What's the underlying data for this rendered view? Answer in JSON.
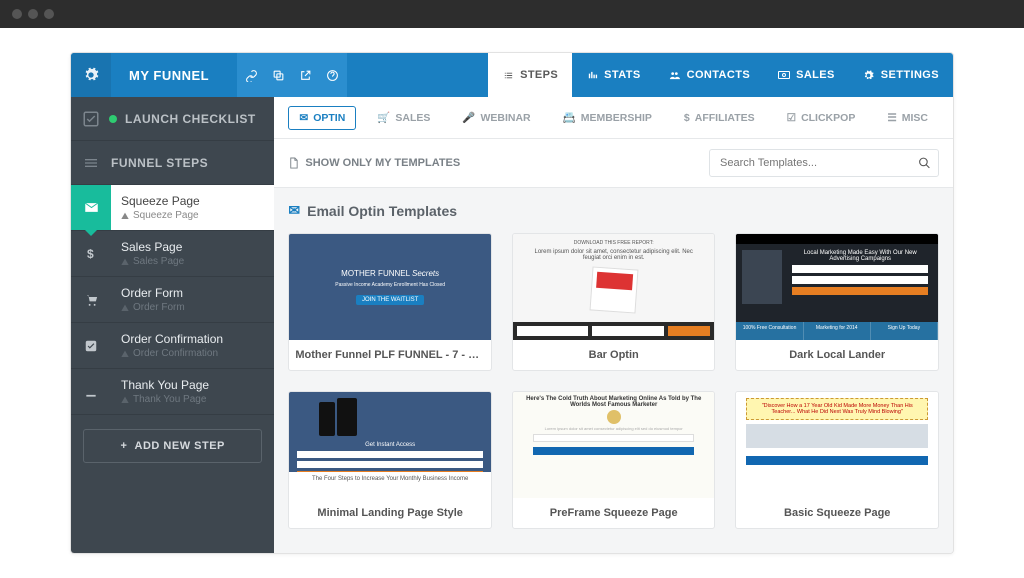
{
  "colors": {
    "primary": "#1a7fc1",
    "accent": "#18bc9c",
    "orange": "#e67e22"
  },
  "browser": {
    "dots": 3
  },
  "header": {
    "title": "MY FUNNEL",
    "nav": [
      {
        "icon": "list-icon",
        "label": "STEPS",
        "active": true
      },
      {
        "icon": "stats-icon",
        "label": "STATS"
      },
      {
        "icon": "contacts-icon",
        "label": "CONTACTS"
      },
      {
        "icon": "sales-icon",
        "label": "SALES"
      },
      {
        "icon": "gear-icon",
        "label": "SETTINGS"
      }
    ]
  },
  "sidebar": {
    "launch_label": "LAUNCH CHECKLIST",
    "steps_label": "FUNNEL STEPS",
    "add_label": "ADD NEW STEP",
    "items": [
      {
        "icon": "envelope-icon",
        "title": "Squeeze Page",
        "sub": "Squeeze Page",
        "active": true
      },
      {
        "icon": "dollar-icon",
        "title": "Sales Page",
        "sub": "Sales Page"
      },
      {
        "icon": "cart-icon",
        "title": "Order Form",
        "sub": "Order Form"
      },
      {
        "icon": "checkbox-icon",
        "title": "Order Confirmation",
        "sub": "Order Confirmation"
      },
      {
        "icon": "download-icon",
        "title": "Thank You Page",
        "sub": "Thank You Page"
      }
    ]
  },
  "filters": [
    {
      "icon": "envelope-icon",
      "label": "OPTIN",
      "active": true
    },
    {
      "icon": "cart-icon",
      "label": "SALES"
    },
    {
      "icon": "mic-icon",
      "label": "WEBINAR"
    },
    {
      "icon": "badge-icon",
      "label": "MEMBERSHIP"
    },
    {
      "icon": "dollar-icon",
      "label": "AFFILIATES"
    },
    {
      "icon": "popup-icon",
      "label": "CLICKPOP"
    },
    {
      "icon": "list-icon",
      "label": "MISC"
    }
  ],
  "controls": {
    "show_only_label": "SHOW ONLY MY TEMPLATES",
    "search_placeholder": "Search Templates...",
    "section_title": "Email Optin Templates"
  },
  "templates": [
    {
      "title": "Mother Funnel PLF FUNNEL - 7 - Ca...",
      "thumb": "tmpl-1"
    },
    {
      "title": "Bar Optin",
      "thumb": "tmpl-2"
    },
    {
      "title": "Dark Local Lander",
      "thumb": "tmpl-3"
    },
    {
      "title": "Minimal Landing Page Style",
      "thumb": "tmpl-4"
    },
    {
      "title": "PreFrame Squeeze Page",
      "thumb": "tmpl-5"
    },
    {
      "title": "Basic Squeeze Page",
      "thumb": "tmpl-6"
    }
  ],
  "thumb_text": {
    "t1_sub": "Passive Income Academy Enrollment Has Closed",
    "t2_head": "DOWNLOAD THIS FREE REPORT:",
    "t2_lip": "Lorem ipsum dolor sit amet, consectetur adipiscing elit. Nec feugiat orci enim in est.",
    "t3_head": "Local Marketing Made Easy With Our New Advertising Campaigns",
    "t3_b1": "100% Free Consultation",
    "t3_b2": "Marketing for 2014",
    "t3_b3": "Sign Up Today",
    "t4_head": "Get Instant Access",
    "t4_foot": "The Four Steps to Increase Your Monthly Business Income",
    "t5_head": "Here's The Cold Truth About Marketing Online As Told by The Worlds Most Famous Marketer",
    "t6_yel": "\"Discover How a 17 Year Old Kid Made More Money Than His Teacher... What He Did Next Was Truly Mind Blowing\""
  }
}
